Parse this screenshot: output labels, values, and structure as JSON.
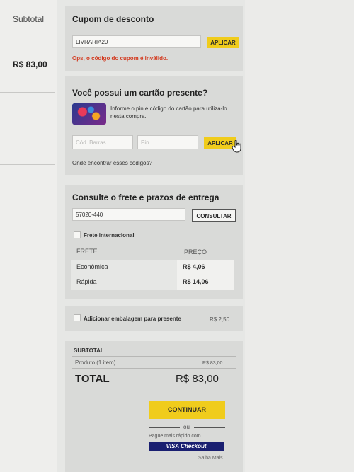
{
  "sidebar": {
    "subtotal_label": "Subtotal",
    "subtotal_value": "R$ 83,00"
  },
  "coupon": {
    "title": "Cupom de desconto",
    "input_value": "LIVRARIA20",
    "apply_label": "APLICAR",
    "error": "Ops, o código do cupom é inválido."
  },
  "giftcard": {
    "title": "Você possui um cartão presente?",
    "description": "Informe o pin e código do cartão para utiliza-lo nesta compra.",
    "code_placeholder": "Cód. Barras",
    "pin_placeholder": "Pin",
    "apply_label": "APLICAR",
    "find_link": "Onde encontrar esses códigos?"
  },
  "shipping": {
    "title": "Consulte o frete e prazos de entrega",
    "cep_value": "57020-440",
    "consult_label": "CONSULTAR",
    "international_label": "Frete internacional",
    "col_freight": "FRETE",
    "col_price": "PREÇO",
    "options": [
      {
        "name": "Econômica",
        "price": "R$ 4,06"
      },
      {
        "name": "Rápida",
        "price": "R$ 14,06"
      }
    ]
  },
  "giftwrap": {
    "label": "Adicionar embalagem para presente",
    "price": "R$ 2,50"
  },
  "summary": {
    "subtotal_label": "SUBTOTAL",
    "product_label": "Produto (1 item)",
    "product_value": "R$ 83,00",
    "total_label": "TOTAL",
    "total_value": "R$ 83,00",
    "continue_label": "CONTINUAR",
    "or_label": "ou",
    "fast_pay_label": "Pague mais rápido com",
    "visa_label": "VISA Checkout",
    "learn_more": "Saiba Mais"
  },
  "colors": {
    "accent": "#f0cc1c",
    "error": "#d33a1f",
    "visa": "#1a1f71"
  }
}
